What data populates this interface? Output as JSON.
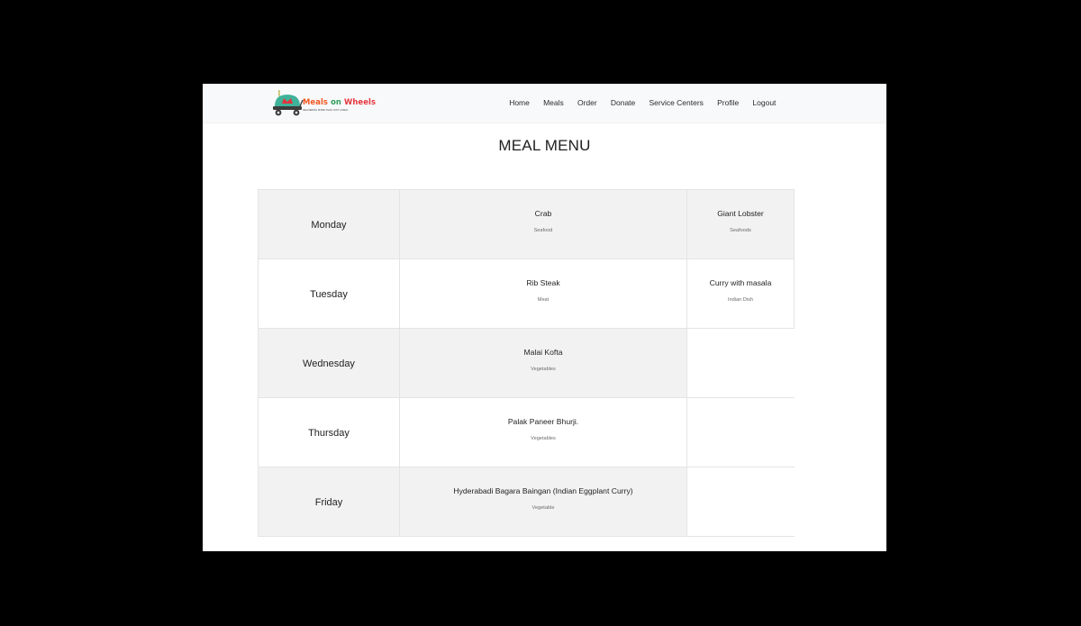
{
  "brand": {
    "name_part1": "Meals",
    "name_part2": "on",
    "name_part3": "Wheels",
    "tagline": "DELIVERING MORE THAN JUST A MEAL"
  },
  "nav": {
    "items": [
      "Home",
      "Meals",
      "Order",
      "Donate",
      "Service Centers",
      "Profile",
      "Logout"
    ]
  },
  "page": {
    "title": "MEAL MENU"
  },
  "menu": {
    "rows": [
      {
        "day": "Monday",
        "meals": [
          {
            "name": "Crab",
            "type": "Seafood"
          },
          {
            "name": "Giant Lobster",
            "type": "Seafoods"
          }
        ]
      },
      {
        "day": "Tuesday",
        "meals": [
          {
            "name": "Rib Steak",
            "type": "Meat"
          },
          {
            "name": "Curry with masala",
            "type": "Indian Dish"
          }
        ]
      },
      {
        "day": "Wednesday",
        "meals": [
          {
            "name": "Malai Kofta",
            "type": "Vegetables"
          }
        ]
      },
      {
        "day": "Thursday",
        "meals": [
          {
            "name": "Palak Paneer Bhurji.",
            "type": "Vegetables"
          }
        ]
      },
      {
        "day": "Friday",
        "meals": [
          {
            "name": "Hyderabadi Bagara Baingan (Indian Eggplant Curry)",
            "type": "Vegetable"
          }
        ]
      }
    ]
  },
  "colors": {
    "page_background": "#000000",
    "navbar": "#f8f9fa",
    "row_shaded": "#f2f2f2",
    "row_plain": "#ffffff",
    "logo_teal": "#3fb39a",
    "logo_red": "#e4353c",
    "logo_orange": "#f0561f",
    "logo_green": "#2f9e5d"
  },
  "icons": {
    "logo": "food-cart-logo-icon"
  }
}
